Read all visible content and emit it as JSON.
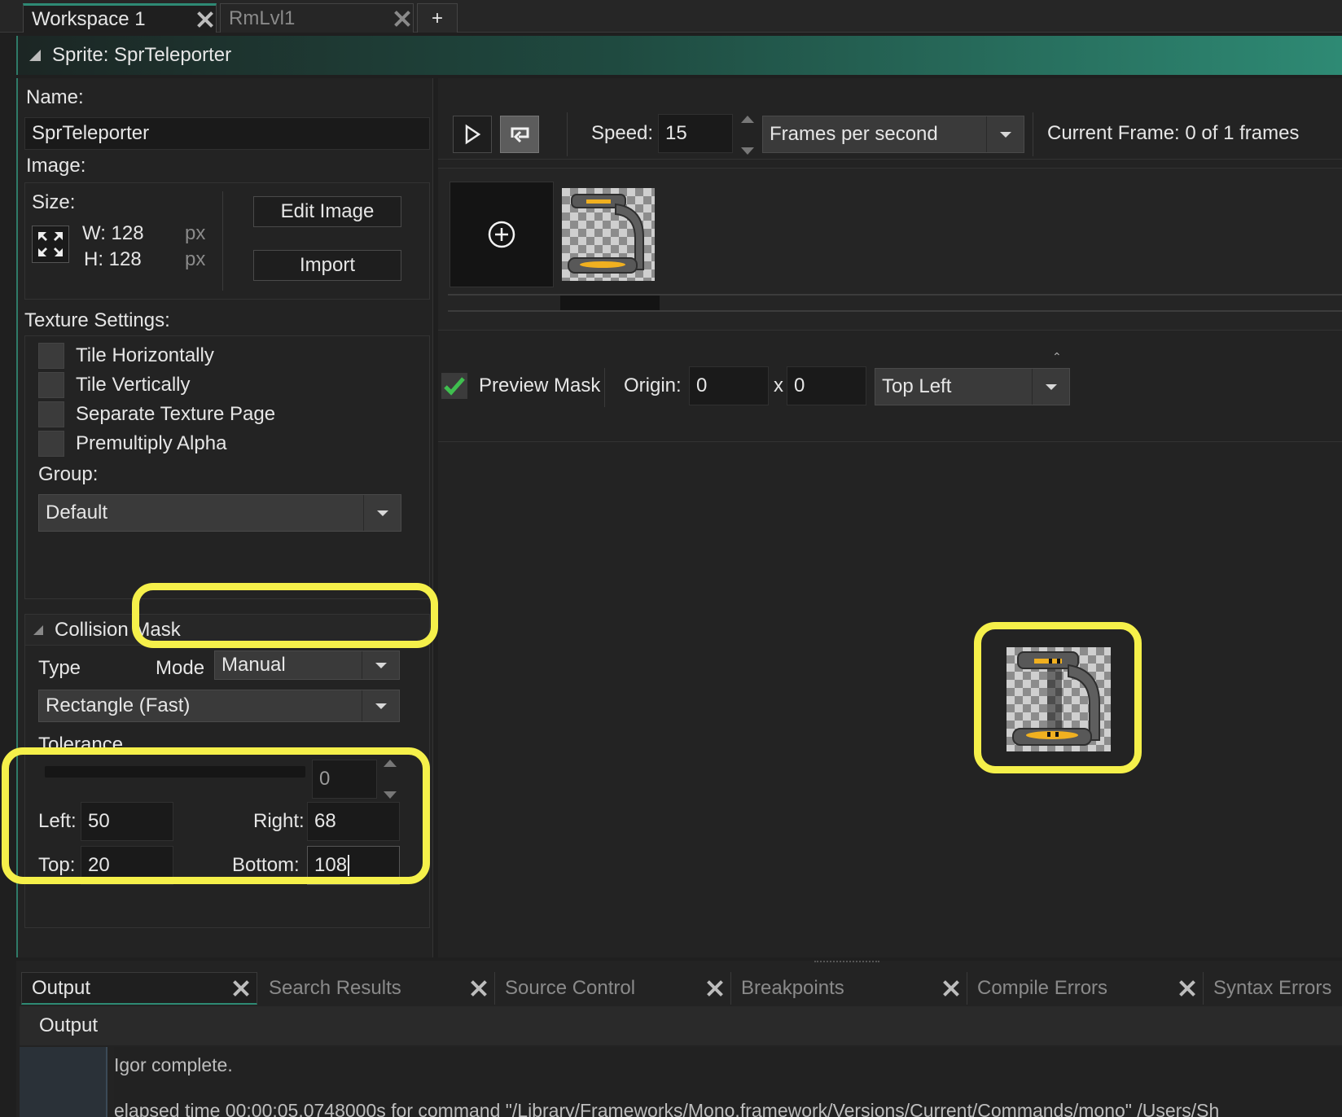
{
  "workspace_tabs": [
    {
      "label": "Workspace 1",
      "active": true
    },
    {
      "label": "RmLvl1",
      "active": false
    }
  ],
  "add_tab_label": "+",
  "sprite_header": "Sprite: SprTeleporter",
  "left": {
    "name_label": "Name:",
    "name_value": "SprTeleporter",
    "image_label": "Image:",
    "size_label": "Size:",
    "width": "W: 128",
    "height": "H: 128",
    "unit": "px",
    "edit_image": "Edit Image",
    "import": "Import",
    "texture_label": "Texture Settings:",
    "texture_options": [
      "Tile Horizontally",
      "Tile Vertically",
      "Separate Texture Page",
      "Premultiply Alpha"
    ],
    "group_label": "Group:",
    "group_value": "Default",
    "collision_title": "Collision Mask",
    "type_label": "Type",
    "mode_label": "Mode",
    "mode_value": "Manual",
    "type_value": "Rectangle (Fast)",
    "tolerance_label": "Tolerance",
    "tolerance_value": "0",
    "left_label": "Left:",
    "left_value": "50",
    "right_label": "Right:",
    "right_value": "68",
    "top_label": "Top:",
    "top_value": "20",
    "bottom_label": "Bottom:",
    "bottom_value": "108"
  },
  "right": {
    "speed_label": "Speed:",
    "speed_value": "15",
    "speed_unit": "Frames per second",
    "current_frame": "Current Frame: 0 of 1 frames",
    "preview_mask": "Preview Mask",
    "preview_mask_checked": true,
    "origin_label": "Origin:",
    "origin_x": "0",
    "origin_sep": "x",
    "origin_y": "0",
    "origin_preset": "Top Left"
  },
  "output": {
    "tabs": [
      "Output",
      "Search Results",
      "Source Control",
      "Breakpoints",
      "Compile Errors",
      "Syntax Errors"
    ],
    "header": "Output",
    "lines": [
      "Igor complete.",
      "elapsed time 00:00:05.0748000s for command \"/Library/Frameworks/Mono.framework/Versions/Current/Commands/mono\" /Users/Sh"
    ]
  },
  "colors": {
    "highlight": "#f5f04a",
    "accent": "#2e8a74",
    "check": "#3fbf4f"
  }
}
